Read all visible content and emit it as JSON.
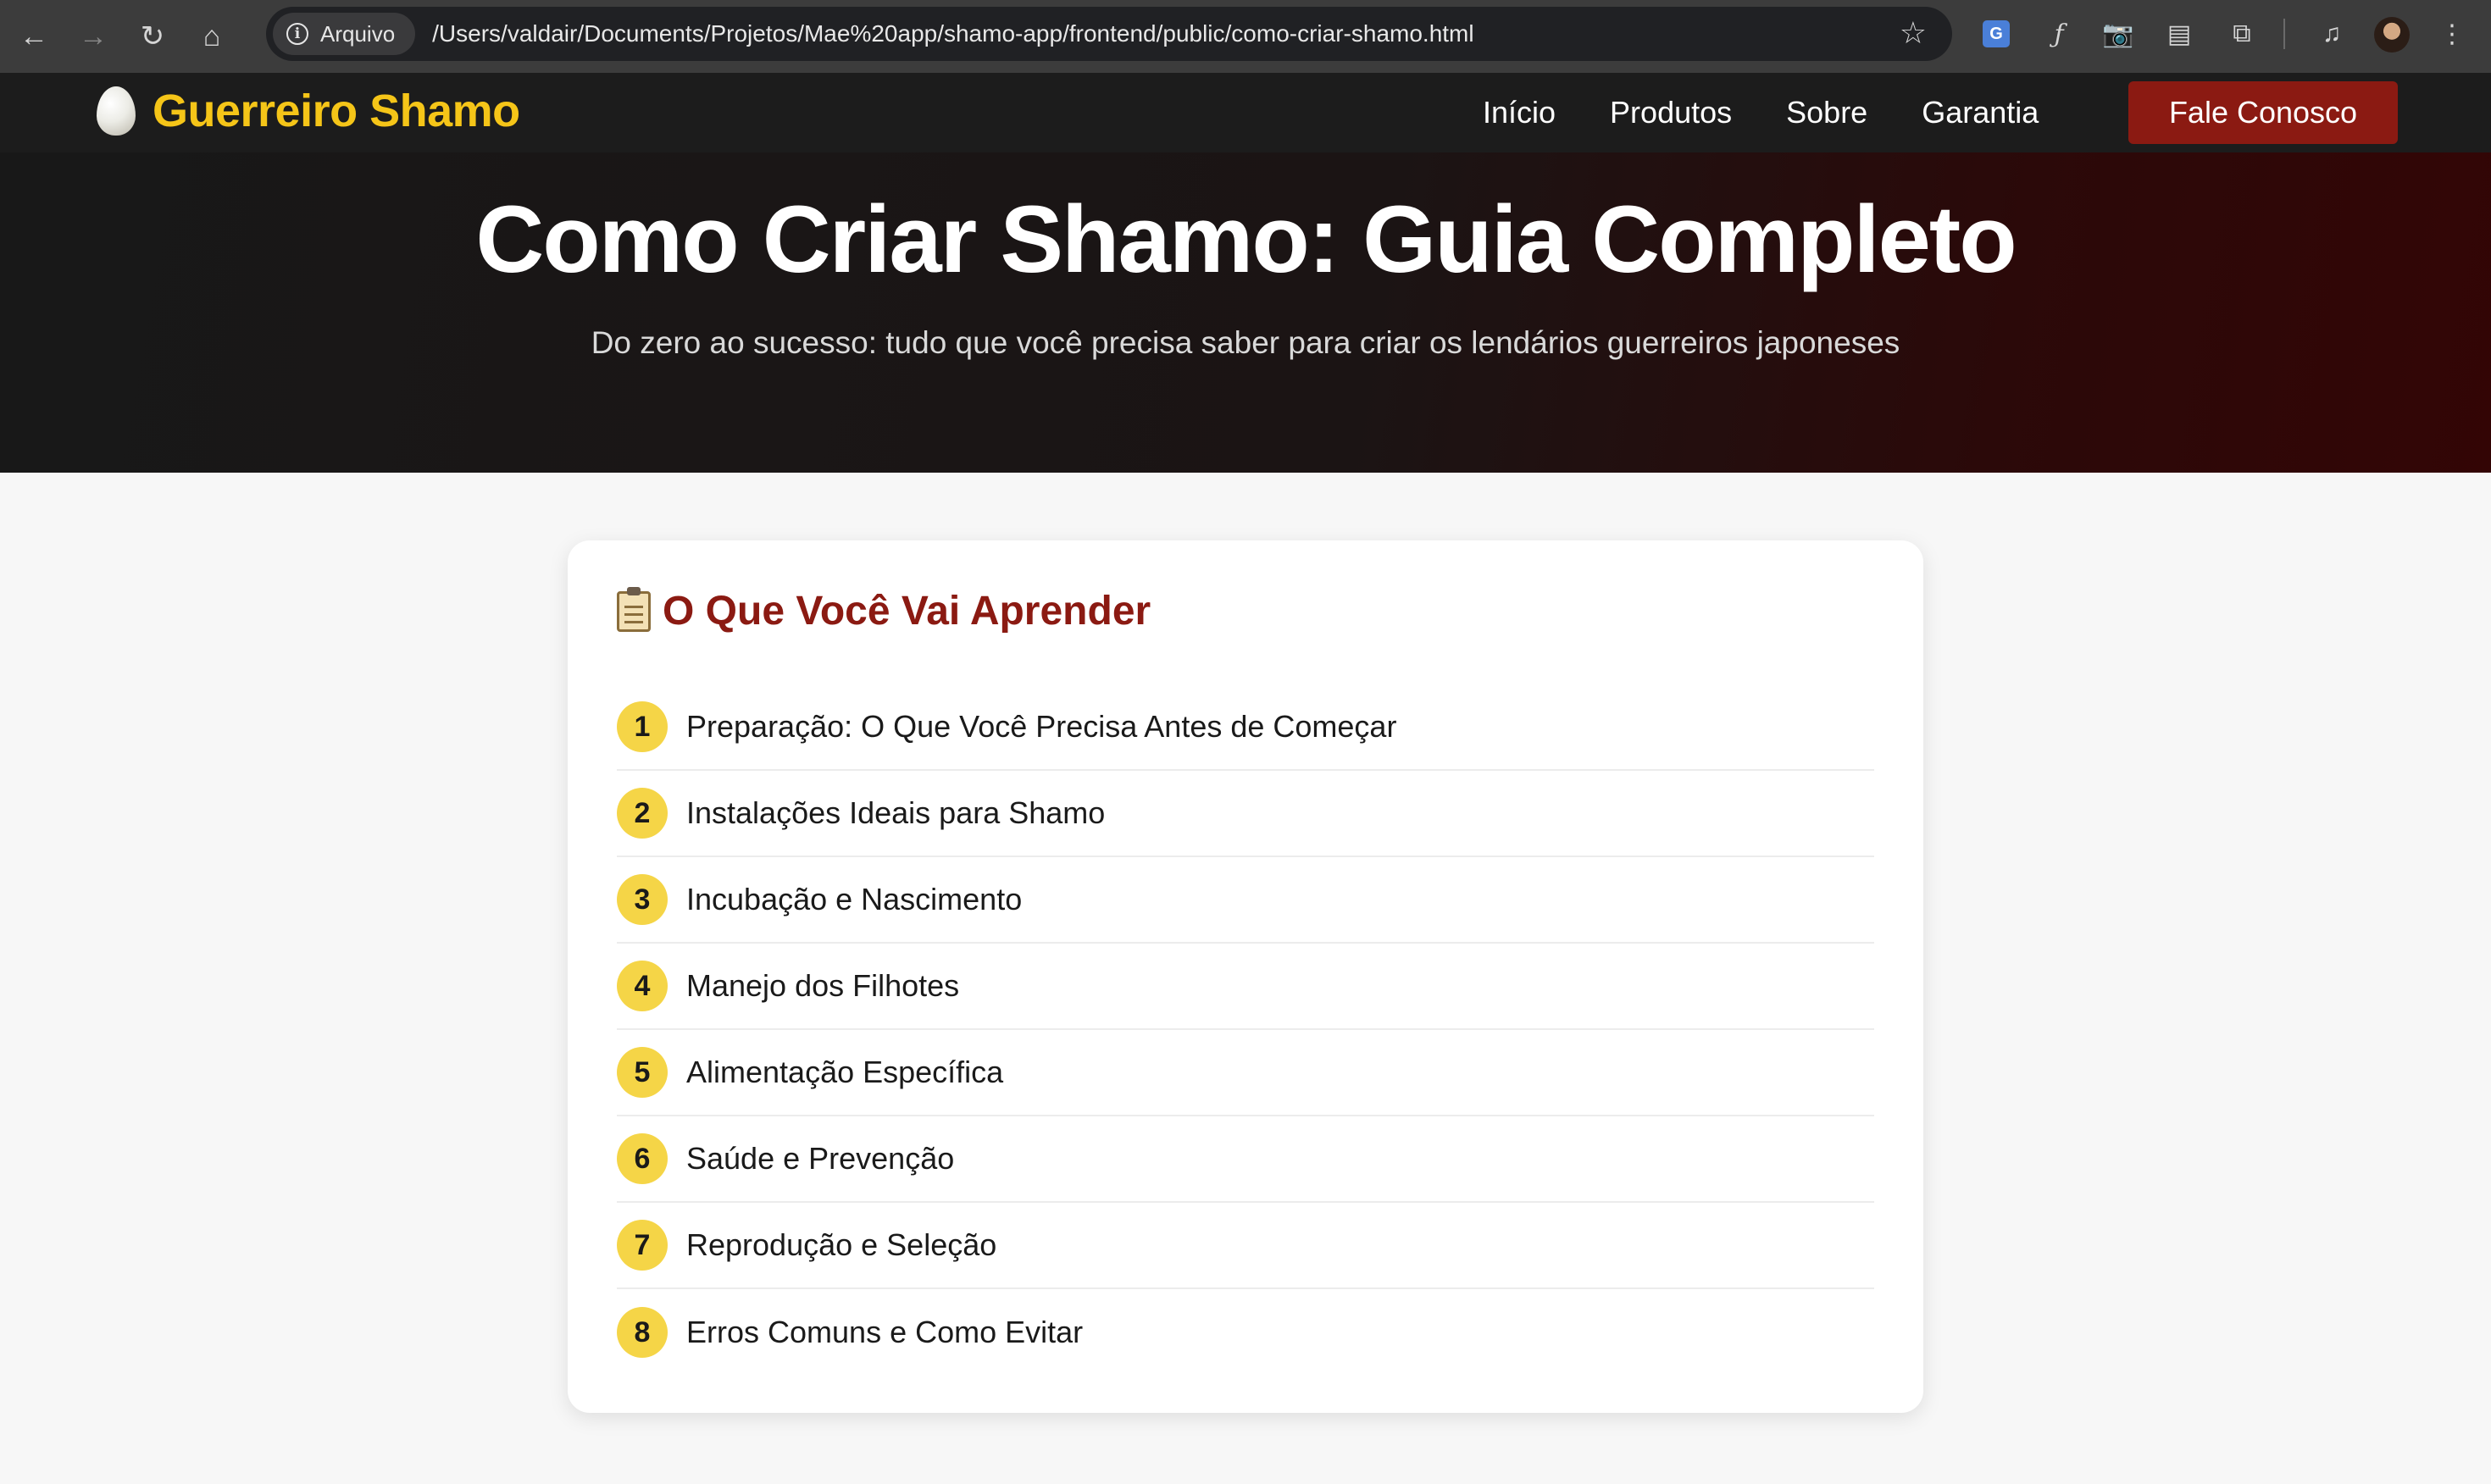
{
  "browser": {
    "security_label": "Arquivo",
    "url": "/Users/valdair/Documents/Projetos/Mae%20app/shamo-app/frontend/public/como-criar-shamo.html",
    "translate_label": "G"
  },
  "header": {
    "brand": "Guerreiro Shamo",
    "nav": [
      "Início",
      "Produtos",
      "Sobre",
      "Garantia"
    ],
    "cta": "Fale Conosco"
  },
  "hero": {
    "title": "Como Criar Shamo: Guia Completo",
    "subtitle": "Do zero ao sucesso: tudo que você precisa saber para criar os lendários guerreiros japoneses"
  },
  "toc": {
    "title": "O Que Você Vai Aprender",
    "items": [
      {
        "num": "1",
        "label": "Preparação: O Que Você Precisa Antes de Começar"
      },
      {
        "num": "2",
        "label": "Instalações Ideais para Shamo"
      },
      {
        "num": "3",
        "label": "Incubação e Nascimento"
      },
      {
        "num": "4",
        "label": "Manejo dos Filhotes"
      },
      {
        "num": "5",
        "label": "Alimentação Específica"
      },
      {
        "num": "6",
        "label": "Saúde e Prevenção"
      },
      {
        "num": "7",
        "label": "Reprodução e Seleção"
      },
      {
        "num": "8",
        "label": "Erros Comuns e Como Evitar"
      }
    ]
  },
  "colors": {
    "brand_gold": "#f5c518",
    "accent_red": "#8b1a12",
    "number_badge": "#f5d547"
  }
}
